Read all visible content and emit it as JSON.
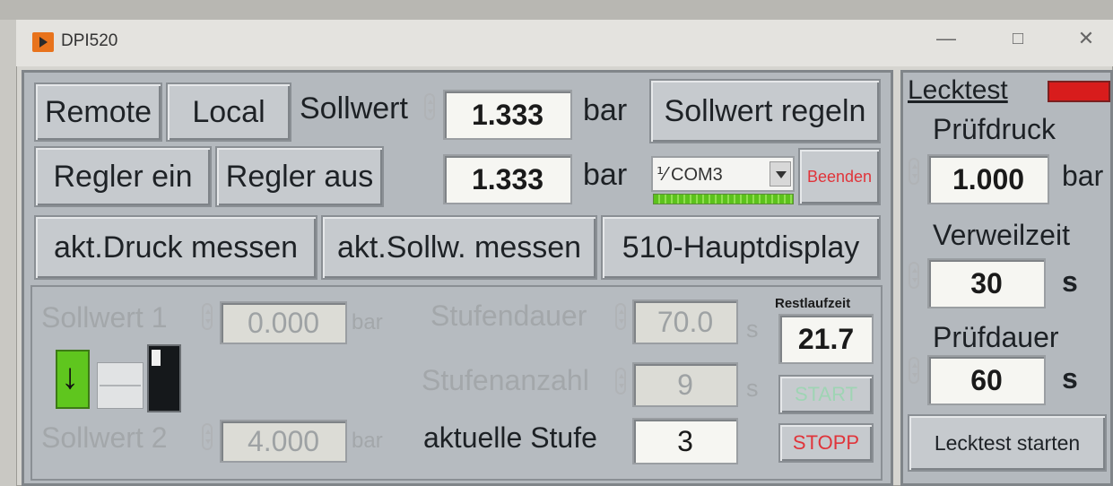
{
  "window": {
    "title": "DPI520",
    "minimize": "—",
    "maximize": "□",
    "close": "✕"
  },
  "top": {
    "remote": "Remote",
    "local": "Local",
    "sollwert_label": "Sollwert",
    "sollwert_value": "1.333",
    "unit_bar": "bar",
    "sollwert_regeln": "Sollwert regeln",
    "regler_ein": "Regler ein",
    "regler_aus": "Regler aus",
    "actual_value": "1.333",
    "com_port": "COM3",
    "com_prefix": "⅟",
    "beenden": "Beenden",
    "akt_druck": "akt.Druck messen",
    "akt_sollw": "akt.Sollw. messen",
    "hauptdisplay": "510-Hauptdisplay"
  },
  "ramp": {
    "sollwert1_label": "Sollwert 1",
    "sollwert1_value": "0.000",
    "sollwert2_label": "Sollwert 2",
    "sollwert2_value": "4.000",
    "unit_bar": "bar",
    "stufendauer_label": "Stufendauer",
    "stufendauer_value": "70.0",
    "stufenanzahl_label": "Stufenanzahl",
    "stufenanzahl_value": "9",
    "unit_s": "s",
    "aktuelle_stufe_label": "aktuelle Stufe",
    "aktuelle_stufe_value": "3",
    "restlaufzeit_label": "Restlaufzeit",
    "restlaufzeit_value": "21.7",
    "start": "START",
    "stopp": "STOPP",
    "direction_arrow": "↓"
  },
  "lecktest": {
    "title": "Lecktest",
    "led_color": "#d81c1c",
    "pruefdruck_label": "Prüfdruck",
    "pruefdruck_value": "1.000",
    "unit_bar": "bar",
    "verweilzeit_label": "Verweilzeit",
    "verweilzeit_value": "30",
    "unit_s": "s",
    "pruefdauer_label": "Prüfdauer",
    "pruefdauer_value": "60",
    "start_button": "Lecktest starten"
  },
  "colors": {
    "accent_green": "#5fc61e",
    "stop_red": "#e0343a",
    "start_disabled": "#9fd4b4"
  }
}
